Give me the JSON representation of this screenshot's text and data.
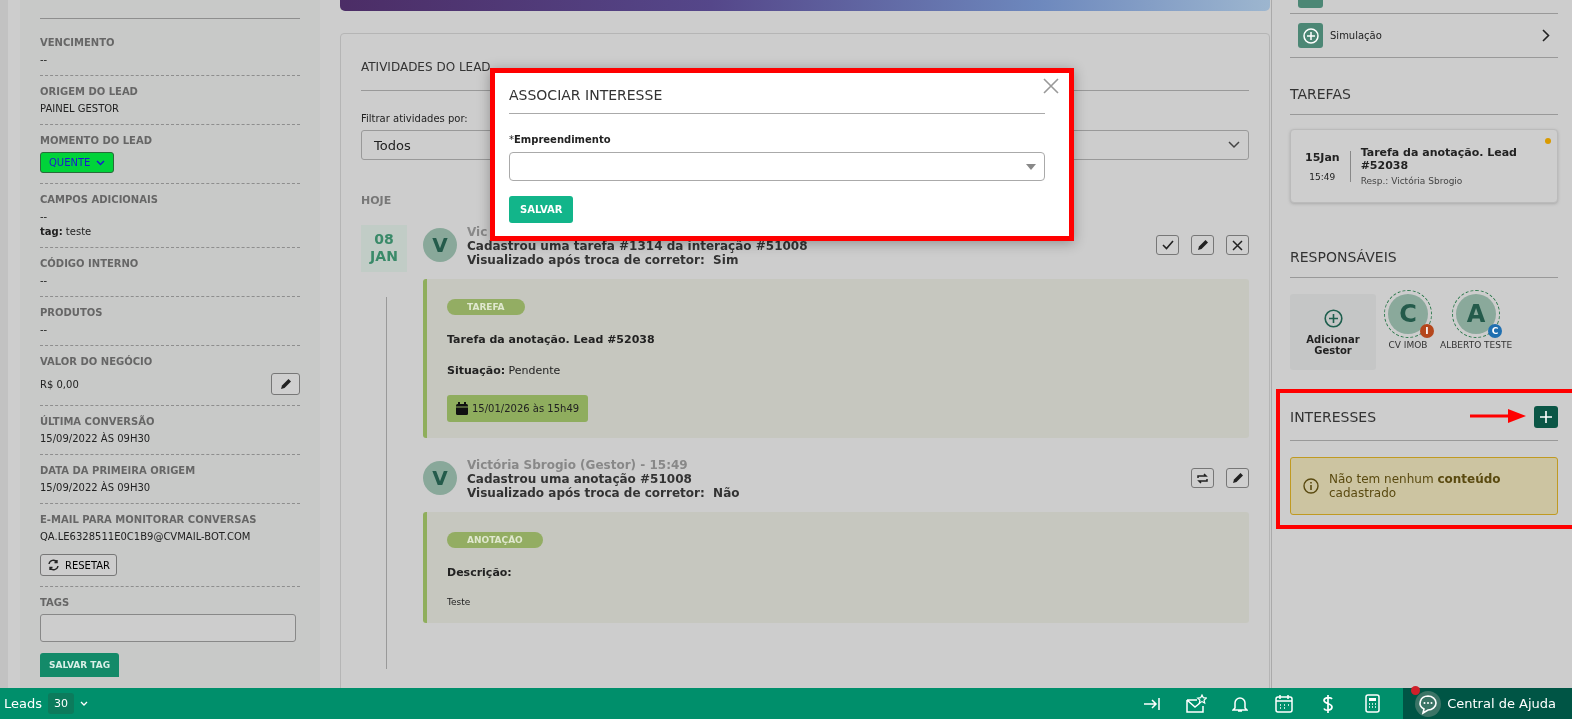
{
  "left_panel": {
    "fields": [
      {
        "kind": "text",
        "label": "VENCIMENTO",
        "value": "--"
      },
      {
        "kind": "text",
        "label": "ORIGEM DO LEAD",
        "value": "PAINEL GESTOR"
      },
      {
        "kind": "moment",
        "label": "MOMENTO DO LEAD",
        "value": "QUENTE",
        "color": "#00d33a"
      },
      {
        "kind": "extras",
        "label": "CAMPOS ADICIONAIS",
        "value": "--",
        "extras": [
          {
            "key": "tag:",
            "value": "teste"
          }
        ]
      },
      {
        "kind": "text",
        "label": "CÓDIGO INTERNO",
        "value": "--"
      },
      {
        "kind": "text",
        "label": "PRODUTOS",
        "value": "--"
      },
      {
        "kind": "edit",
        "label": "VALOR DO NEGÓCIO",
        "value": "R$ 0,00"
      },
      {
        "kind": "text",
        "label": "ÚLTIMA CONVERSÃO",
        "value": " 15/09/2022 ÀS 09H30"
      },
      {
        "kind": "text",
        "label": "DATA DA PRIMEIRA ORIGEM",
        "value": "15/09/2022 ÀS 09H30"
      },
      {
        "kind": "reset",
        "label": "E-MAIL PARA MONITORAR CONVERSAS",
        "value": "QA.LE6328511E0C1B9@CVMAIL-BOT.COM",
        "button": "RESETAR"
      },
      {
        "kind": "tags",
        "label": "TAGS",
        "button": "SALVAR TAG"
      }
    ]
  },
  "activities_panel": {
    "title": "ATIVIDADES DO LEAD",
    "filter_label": "Filtrar atividades por:",
    "filter_value": "Todos",
    "day": "HOJE",
    "date": {
      "day": "08",
      "month": "JAN"
    },
    "activities": [
      {
        "avatar": "V",
        "author": "Vic",
        "text": "Cadastrou uma tarefa #1314 da interação #51008",
        "viewed_label": "Visualizado após troca de corretor:",
        "viewed_value": "Sim",
        "detail": {
          "kind": "task",
          "tag": "TAREFA",
          "title": "Tarefa da anotação. Lead #52038",
          "status_label": "Situação:",
          "status_value": "Pendente",
          "due": "15/01/2026 às 15h49"
        }
      },
      {
        "avatar": "V",
        "author": "Victória Sbrogio (Gestor) - 15:49",
        "text": "Cadastrou uma anotação #51008",
        "viewed_label": "Visualizado após troca de corretor:",
        "viewed_value": "Não",
        "detail": {
          "kind": "note",
          "tag": "ANOTAÇÃO",
          "title": "Descrição:",
          "body": "Teste"
        }
      }
    ]
  },
  "right_panel": {
    "menu_items": [
      {
        "label": "Simulação"
      }
    ],
    "tasks_title": "TAREFAS",
    "tasks": [
      {
        "day": "15Jan",
        "time": "15:49",
        "title": "Tarefa da anotação. Lead #52038",
        "owner": "Resp.: Victória Sbrogio",
        "color": "#d99a00"
      }
    ],
    "owners_title": "RESPONSÁVEIS",
    "add_owner": "Adicionar Gestor",
    "owners": [
      {
        "initial": "C",
        "name": "CV IMOB",
        "badge": "I",
        "color": "#b5471c"
      },
      {
        "initial": "A",
        "name": "ALBERTO TESTE",
        "badge": "C",
        "color": "#1f6fb0"
      }
    ],
    "interests_title": "INTERESSES",
    "interests_empty": "Não tem nenhum **conteúdo** cadastrado"
  },
  "modal": {
    "title": "ASSOCIAR INTERESSE",
    "field_label": "Empreendimento",
    "required_mark": "*",
    "button": "SALVAR"
  },
  "bottom_bar": {
    "label": "Leads",
    "count": "30",
    "help": "Central de Ajuda",
    "help_alert": true
  }
}
